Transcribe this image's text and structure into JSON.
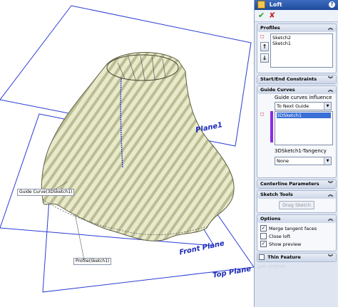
{
  "viewport": {
    "plane_labels": [
      "Plane1",
      "Front Plane",
      "Top Plane"
    ],
    "callouts": [
      "Guide Curve(3DSketch1)",
      "Profile(Sketch1)"
    ]
  },
  "property_manager": {
    "title": "Loft",
    "help_glyph": "?",
    "ok_glyph": "✔",
    "cancel_glyph": "✘",
    "sections": {
      "profiles": {
        "header": "Profiles",
        "items": [
          "Sketch2",
          "Sketch1"
        ],
        "up_glyph": "↑",
        "down_glyph": "↓"
      },
      "constraints": {
        "header": "Start/End Constraints"
      },
      "guide_curves": {
        "header": "Guide Curves",
        "influence_label": "Guide curves influence",
        "influence_value": "To Next Guide",
        "items": [
          "3DSketch1"
        ],
        "tangency_label": "3DSketch1-Tangency",
        "tangency_value": "None"
      },
      "centerline": {
        "header": "Centerline Parameters"
      },
      "sketch_tools": {
        "header": "Sketch Tools",
        "drag_label": "Drag Sketch"
      },
      "options": {
        "header": "Options",
        "checkboxes": [
          {
            "label": "Merge tangent faces",
            "checked": true
          },
          {
            "label": "Close loft",
            "checked": false
          },
          {
            "label": "Show preview",
            "checked": true
          }
        ]
      },
      "thin_feature": {
        "header": "Thin Feature",
        "checked": false,
        "under_text": "Thin Feature"
      }
    }
  },
  "colors": {
    "plane": "#2b3dd4",
    "surface": "#e6e8c6",
    "surface_stripe": "#b8b98e",
    "guide_list_accent": "#8a2be2",
    "title_bar": "#2a5aac"
  }
}
